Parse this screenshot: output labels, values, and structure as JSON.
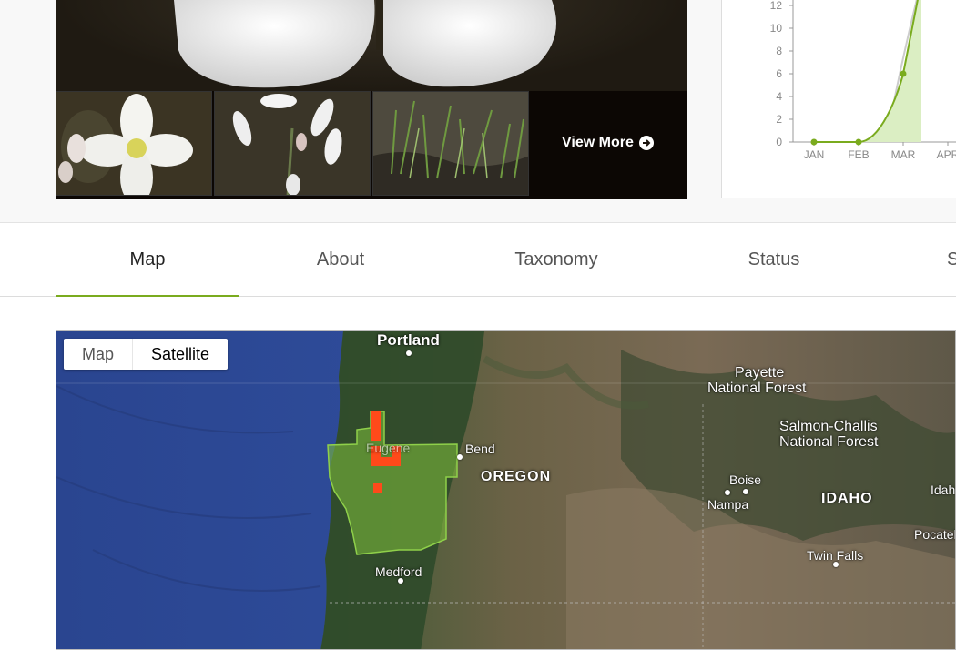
{
  "gallery": {
    "view_more": "View More"
  },
  "chart_data": {
    "type": "area",
    "categories": [
      "JAN",
      "FEB",
      "MAR",
      "APR"
    ],
    "y_ticks": [
      0,
      2,
      4,
      6,
      8,
      10,
      12
    ],
    "ylim": [
      0,
      12
    ],
    "series": [
      {
        "values": [
          0,
          0,
          6,
          14
        ]
      }
    ],
    "color": "#7aab1e",
    "fill": "#dbeec3"
  },
  "tabs": [
    {
      "label": "Map",
      "active": true
    },
    {
      "label": "About",
      "active": false
    },
    {
      "label": "Taxonomy",
      "active": false
    },
    {
      "label": "Status",
      "active": false
    },
    {
      "label": "S",
      "active": false
    }
  ],
  "map": {
    "toggle": {
      "map_label": "Map",
      "satellite_label": "Satellite",
      "active": "Satellite"
    },
    "labels": {
      "portland": "Portland",
      "bend": "Bend",
      "oregon": "OREGON",
      "eugene": "Eugene",
      "medford": "Medford",
      "payette": "Payette",
      "payette_forest": "National Forest",
      "salmon": "Salmon-Challis",
      "salmon_forest": "National Forest",
      "boise": "Boise",
      "nampa": "Nampa",
      "idaho": "IDAHO",
      "idaho_falls": "Idaho",
      "pocatello": "Pocatel",
      "twin_falls": "Twin Falls"
    },
    "colors": {
      "range_fill": "#7ab83a",
      "observation": "#ff4a1a"
    }
  }
}
